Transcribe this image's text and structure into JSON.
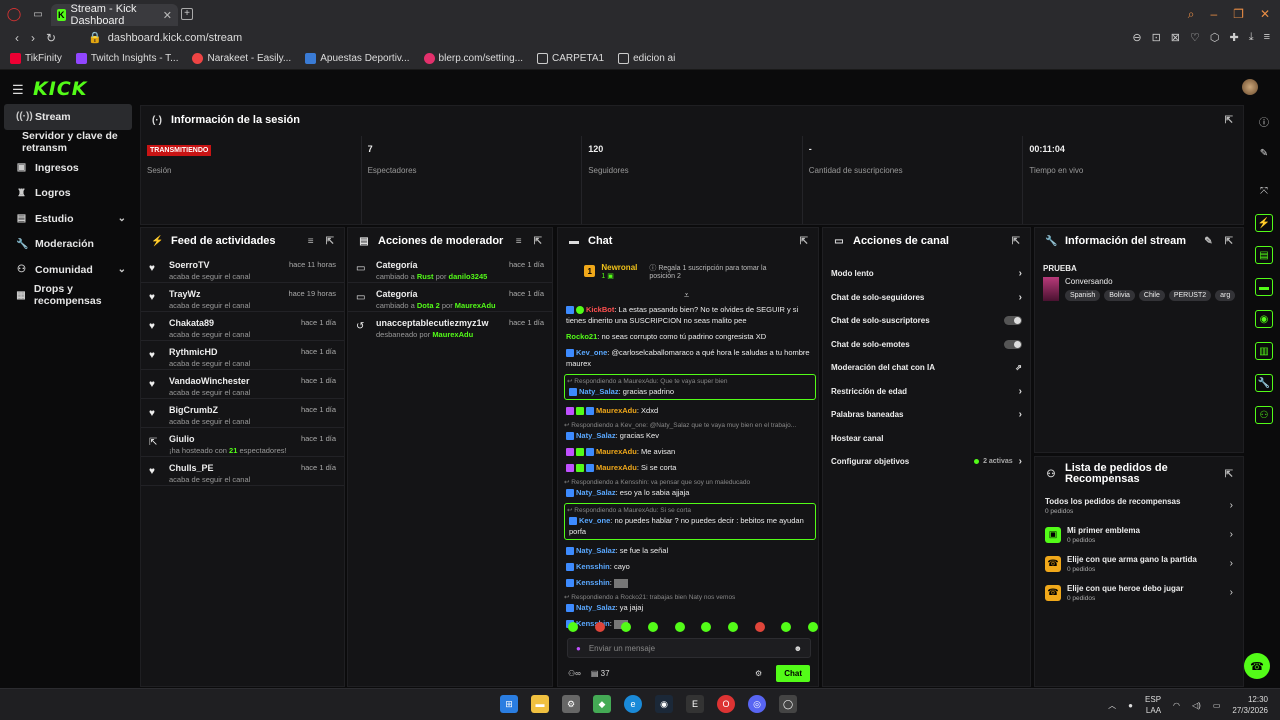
{
  "browser": {
    "tab_title": "Stream - Kick Dashboard",
    "url": "dashboard.kick.com/stream",
    "bookmarks": [
      "TikFinity",
      "Twitch Insights - T...",
      "Narakeet - Easily...",
      "Apuestas Deportiv...",
      "blerp.com/setting...",
      "CARPETA1",
      "edicion ai"
    ]
  },
  "app": {
    "logo": "KICK"
  },
  "sidebar": {
    "items": [
      {
        "label": "Stream",
        "icon": "broadcast-icon"
      },
      {
        "label": "Servidor y clave de retransm",
        "icon": ""
      },
      {
        "label": "Ingresos",
        "icon": "wallet-icon"
      },
      {
        "label": "Logros",
        "icon": "trophy-icon"
      },
      {
        "label": "Estudio",
        "icon": "studio-icon"
      },
      {
        "label": "Moderación",
        "icon": "wrench-icon"
      },
      {
        "label": "Comunidad",
        "icon": "community-icon"
      },
      {
        "label": "Drops y recompensas",
        "icon": "gift-icon"
      }
    ]
  },
  "session": {
    "title": "Información de la sesión",
    "stats": [
      {
        "value": "TRANSMITIENDO",
        "label": "Sesión"
      },
      {
        "value": "7",
        "label": "Espectadores"
      },
      {
        "value": "120",
        "label": "Seguidores"
      },
      {
        "value": "-",
        "label": "Cantidad de suscripciones"
      },
      {
        "value": "00:11:04",
        "label": "Tiempo en vivo"
      }
    ]
  },
  "feed": {
    "title": "Feed de actividades",
    "items": [
      {
        "name": "SoerroTV",
        "sub": "acaba de seguir el canal",
        "time": "hace 11 horas"
      },
      {
        "name": "TrayWz",
        "sub": "acaba de seguir el canal",
        "time": "hace 19 horas"
      },
      {
        "name": "Chakata89",
        "sub": "acaba de seguir el canal",
        "time": "hace 1 día"
      },
      {
        "name": "RythmicHD",
        "sub": "acaba de seguir el canal",
        "time": "hace 1 día"
      },
      {
        "name": "VandaoWinchester",
        "sub": "acaba de seguir el canal",
        "time": "hace 1 día"
      },
      {
        "name": "BigCrumbZ",
        "sub": "acaba de seguir el canal",
        "time": "hace 1 día"
      },
      {
        "name": "Giulio",
        "sub_pre": "¡ha hosteado con ",
        "sub_num": "21",
        "sub_post": " espectadores!",
        "time": "hace 1 día"
      },
      {
        "name": "Chulls_PE",
        "sub": "acaba de seguir el canal",
        "time": "hace 1 día"
      }
    ]
  },
  "mod": {
    "title": "Acciones de moderador",
    "items": [
      {
        "name": "Categoría",
        "pre": "cambiado a ",
        "target": "Rust",
        "mid": " por ",
        "by": "danilo3245",
        "time": "hace 1 día"
      },
      {
        "name": "Categoría",
        "pre": "cambiado a ",
        "target": "Dota 2",
        "mid": " por ",
        "by": "MaurexAdu",
        "time": "hace 1 día"
      },
      {
        "name": "unacceptablecutiezmyz1w",
        "pre": "desbaneado por ",
        "by": "MaurexAdu",
        "time": "hace 1 día"
      }
    ]
  },
  "chat": {
    "title": "Chat",
    "pinned": {
      "rank": "1",
      "name": "Newronal",
      "subs": "1",
      "text": "Regala 1 suscripción para tomar la posición 2"
    },
    "placeholder": "Enviar un mensaje",
    "viewers": "37",
    "send": "Chat",
    "messages": [
      {
        "user": "KickBot",
        "text": "La estas pasando bien? No te olvides de SEGUIR y si tienes dinerito una SUSCRIPCION no seas malito pee"
      },
      {
        "user": "Rocko21",
        "text": "no seas corrupto como tú padrino congresista XD"
      },
      {
        "user": "Kev_one",
        "text": "@carloselcaballomaraco a qué hora le saludas a tu hombre maurex"
      },
      {
        "reply_to": "Respondiendo a MaurexAdu: Que te vaya super bien",
        "user": "Naty_Salaz",
        "text": "gracias padrino"
      },
      {
        "user": "MaurexAdu",
        "text": "Xdxd"
      },
      {
        "reply_to": "Respondiendo a Kev_one: @Naty_Salaz que te vaya muy bien en el trabajo...",
        "user": "Naty_Salaz",
        "text": "gracias Kev"
      },
      {
        "user": "MaurexAdu",
        "text": "Me avisan"
      },
      {
        "user": "MaurexAdu",
        "text": "Si se corta"
      },
      {
        "reply_to": "Respondiendo a Kensshin: va pensar que soy un maleducado",
        "user": "Naty_Salaz",
        "text": "eso ya lo sabia ajjaja"
      },
      {
        "reply_to": "Respondiendo a MaurexAdu: Si se corta",
        "user": "Kev_one",
        "text": "no puedes hablar ? no puedes decir : bebitos me ayudan porfa"
      },
      {
        "user": "Naty_Salaz",
        "text": "se fue la señal"
      },
      {
        "user": "Kensshin",
        "text": "cayo"
      },
      {
        "user": "Kensshin",
        "text": ""
      },
      {
        "reply_to": "Respondiendo a Rocko21: trabajas bien Naty nos vemos",
        "user": "Naty_Salaz",
        "text": "ya jajaj"
      },
      {
        "user": "Kensshin",
        "text": ""
      }
    ]
  },
  "canal": {
    "title": "Acciones de canal",
    "items": [
      "Modo lento",
      "Chat de solo-seguidores",
      "Chat de solo-suscriptores",
      "Chat de solo-emotes",
      "Moderación del chat con IA",
      "Restricción de edad",
      "Palabras baneadas",
      "Hostear canal",
      "Configurar objetivos"
    ],
    "goals_active": "2 activas"
  },
  "stream_info": {
    "title": "Información del stream",
    "stream_title": "PRUEBA",
    "category": "Conversando",
    "tags": [
      "Spanish",
      "Bolivia",
      "Chile",
      "PERUST2",
      "arg"
    ]
  },
  "rewards": {
    "title": "Lista de pedidos de Recompensas",
    "items": [
      {
        "name": "Todos los pedidos de recompensas",
        "sub": "0 pedidos"
      },
      {
        "name": "Mi primer emblema",
        "sub": "0 pedidos",
        "color": "#53fc18"
      },
      {
        "name": "Elije con que arma gano la partida",
        "sub": "0 pedidos",
        "color": "#f0a81a"
      },
      {
        "name": "Elije con que heroe debo jugar",
        "sub": "0 pedidos",
        "color": "#f0a81a"
      }
    ]
  },
  "taskbar": {
    "lang1": "ESP",
    "lang2": "LAA",
    "time": "12:30",
    "date": "27/3/2026"
  }
}
